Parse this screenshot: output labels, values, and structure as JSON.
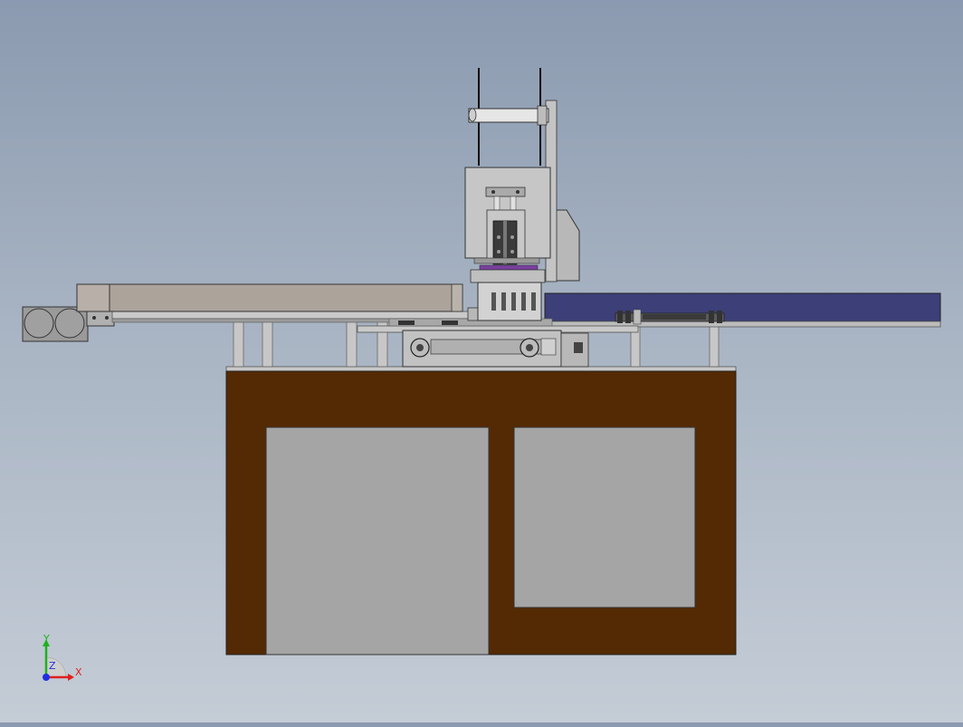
{
  "viewport": {
    "background_top": "#8b9ab0",
    "background_bottom": "#c4ccd6"
  },
  "colors": {
    "cabinet": "#542a04",
    "panel": "#a5a5a5",
    "conveyor_blue": "#3c3f78",
    "hopper": "#aca39a",
    "metal": "#c4c4c4",
    "dark_metal": "#4a4a4a",
    "purple_accent": "#7a3fa0"
  },
  "triad": {
    "y_label": "Y",
    "x_label": "X",
    "z_label": "Z",
    "x_color": "#e02020",
    "y_color": "#20b020",
    "z_color": "#2030e0"
  }
}
